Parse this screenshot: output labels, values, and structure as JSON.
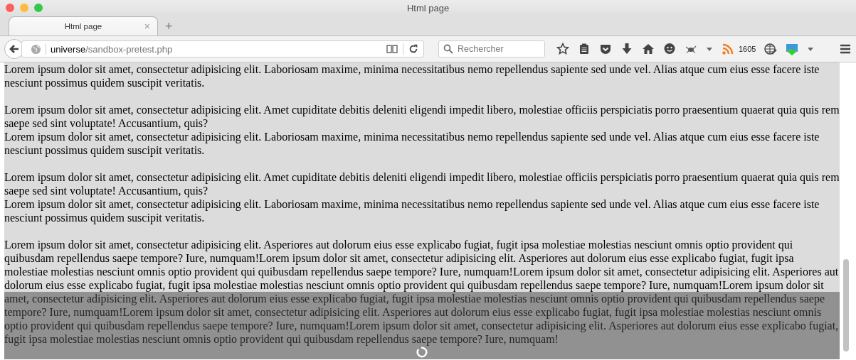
{
  "window": {
    "title": "Html page"
  },
  "tabs": [
    {
      "label": "Html page",
      "selected": true,
      "close": "×"
    }
  ],
  "new_tab": "+",
  "address": {
    "host": "universe",
    "path": "/sandbox-pretest.php"
  },
  "search": {
    "placeholder": "Rechercher"
  },
  "feed_count": "1605",
  "content": {
    "blocks": [
      [
        "Lorem ipsum dolor sit amet, consectetur adipisicing elit. Laboriosam maxime, minima necessitatibus nemo repellendus sapiente sed unde vel. Alias atque cum eius esse facere iste nesciunt possimus quidem suscipit veritatis."
      ],
      [
        "Lorem ipsum dolor sit amet, consectetur adipisicing elit. Amet cupiditate debitis deleniti eligendi impedit libero, molestiae officiis perspiciatis porro praesentium quaerat quia quis rem saepe sed sint voluptate! Accusantium, quis?",
        "Lorem ipsum dolor sit amet, consectetur adipisicing elit. Laboriosam maxime, minima necessitatibus nemo repellendus sapiente sed unde vel. Alias atque cum eius esse facere iste nesciunt possimus quidem suscipit veritatis."
      ],
      [
        "Lorem ipsum dolor sit amet, consectetur adipisicing elit. Amet cupiditate debitis deleniti eligendi impedit libero, molestiae officiis perspiciatis porro praesentium quaerat quia quis rem saepe sed sint voluptate! Accusantium, quis?",
        "Lorem ipsum dolor sit amet, consectetur adipisicing elit. Laboriosam maxime, minima necessitatibus nemo repellendus sapiente sed unde vel. Alias atque cum eius esse facere iste nesciunt possimus quidem suscipit veritatis."
      ],
      [
        "Lorem ipsum dolor sit amet, consectetur adipisicing elit. Asperiores aut dolorum eius esse explicabo fugiat, fugit ipsa molestiae molestias nesciunt omnis optio provident qui quibusdam repellendus saepe tempore? Iure, numquam!Lorem ipsum dolor sit amet, consectetur adipisicing elit. Asperiores aut dolorum eius esse explicabo fugiat, fugit ipsa molestiae molestias nesciunt omnis optio provident qui quibusdam repellendus saepe tempore? Iure, numquam!Lorem ipsum dolor sit amet, consectetur adipisicing elit. Asperiores aut dolorum eius esse explicabo fugiat, fugit ipsa molestiae molestias nesciunt omnis optio provident qui quibusdam repellendus saepe tempore? Iure, numquam!Lorem ipsum dolor sit amet, consectetur adipisicing elit. Asperiores aut dolorum eius esse explicabo fugiat, fugit ipsa molestiae molestias nesciunt omnis optio provident qui quibusdam repellendus saepe tempore? Iure, numquam!Lorem ipsum dolor sit amet, consectetur adipisicing elit. Asperiores aut dolorum eius esse explicabo fugiat, fugit ipsa molestiae molestias nesciunt omnis optio provident qui quibusdam repellendus saepe tempore? Iure, numquam!Lorem ipsum dolor sit amet, consectetur adipisicing elit. Asperiores aut dolorum eius esse explicabo fugiat, fugit ipsa molestiae molestias nesciunt omnis optio provident qui quibusdam repellendus saepe tempore? Iure, numquam!"
      ]
    ]
  },
  "loading": true
}
